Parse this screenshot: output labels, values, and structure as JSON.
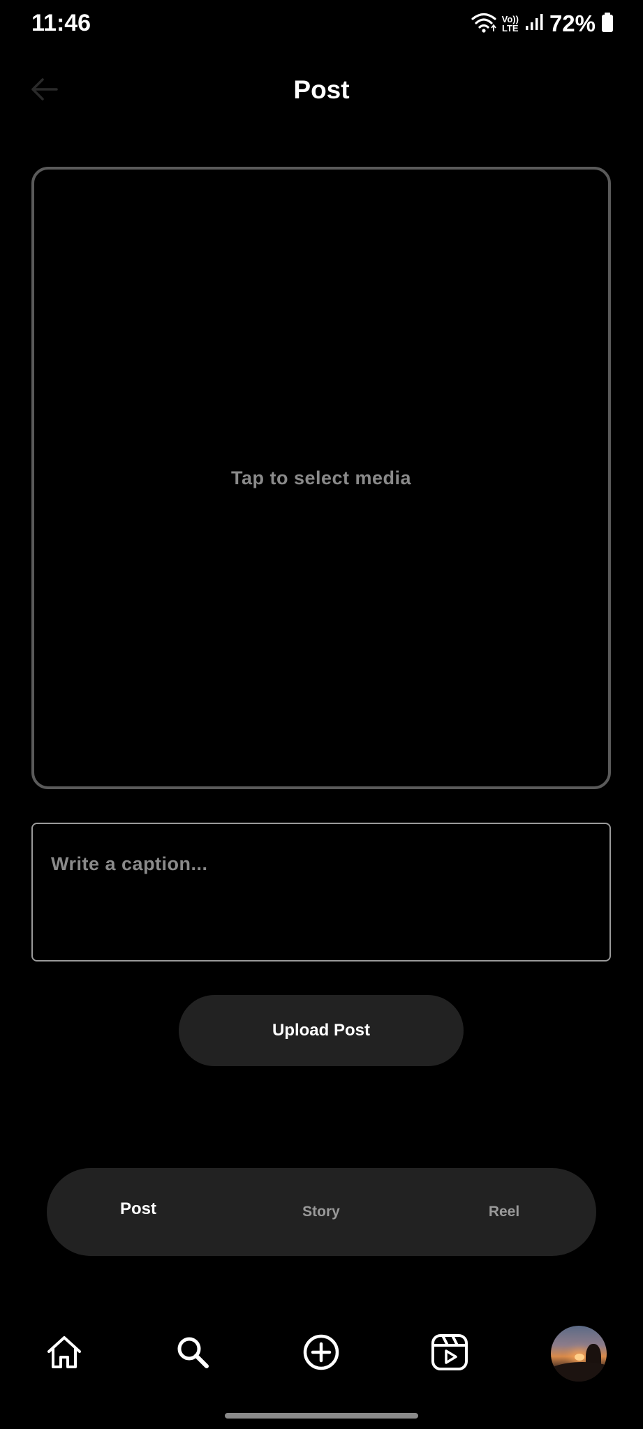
{
  "status_bar": {
    "time": "11:46",
    "network_label_top": "Vo))",
    "network_label_bottom": "LTE",
    "battery": "72%"
  },
  "header": {
    "title": "Post"
  },
  "media_picker": {
    "label": "Tap to select media"
  },
  "caption": {
    "placeholder": "Write a caption...",
    "value": ""
  },
  "upload_button": {
    "label": "Upload Post"
  },
  "mode_tabs": [
    {
      "label": "Post",
      "active": true
    },
    {
      "label": "Story",
      "active": false
    },
    {
      "label": "Reel",
      "active": false
    }
  ],
  "bottom_nav": [
    {
      "icon": "home-icon"
    },
    {
      "icon": "search-icon"
    },
    {
      "icon": "add-circle-icon"
    },
    {
      "icon": "reels-icon"
    },
    {
      "icon": "profile-avatar"
    }
  ],
  "colors": {
    "background": "#000000",
    "surface": "#222222",
    "text_primary": "#ffffff",
    "text_muted": "#8a8a8a",
    "border": "#5a5a5a"
  }
}
